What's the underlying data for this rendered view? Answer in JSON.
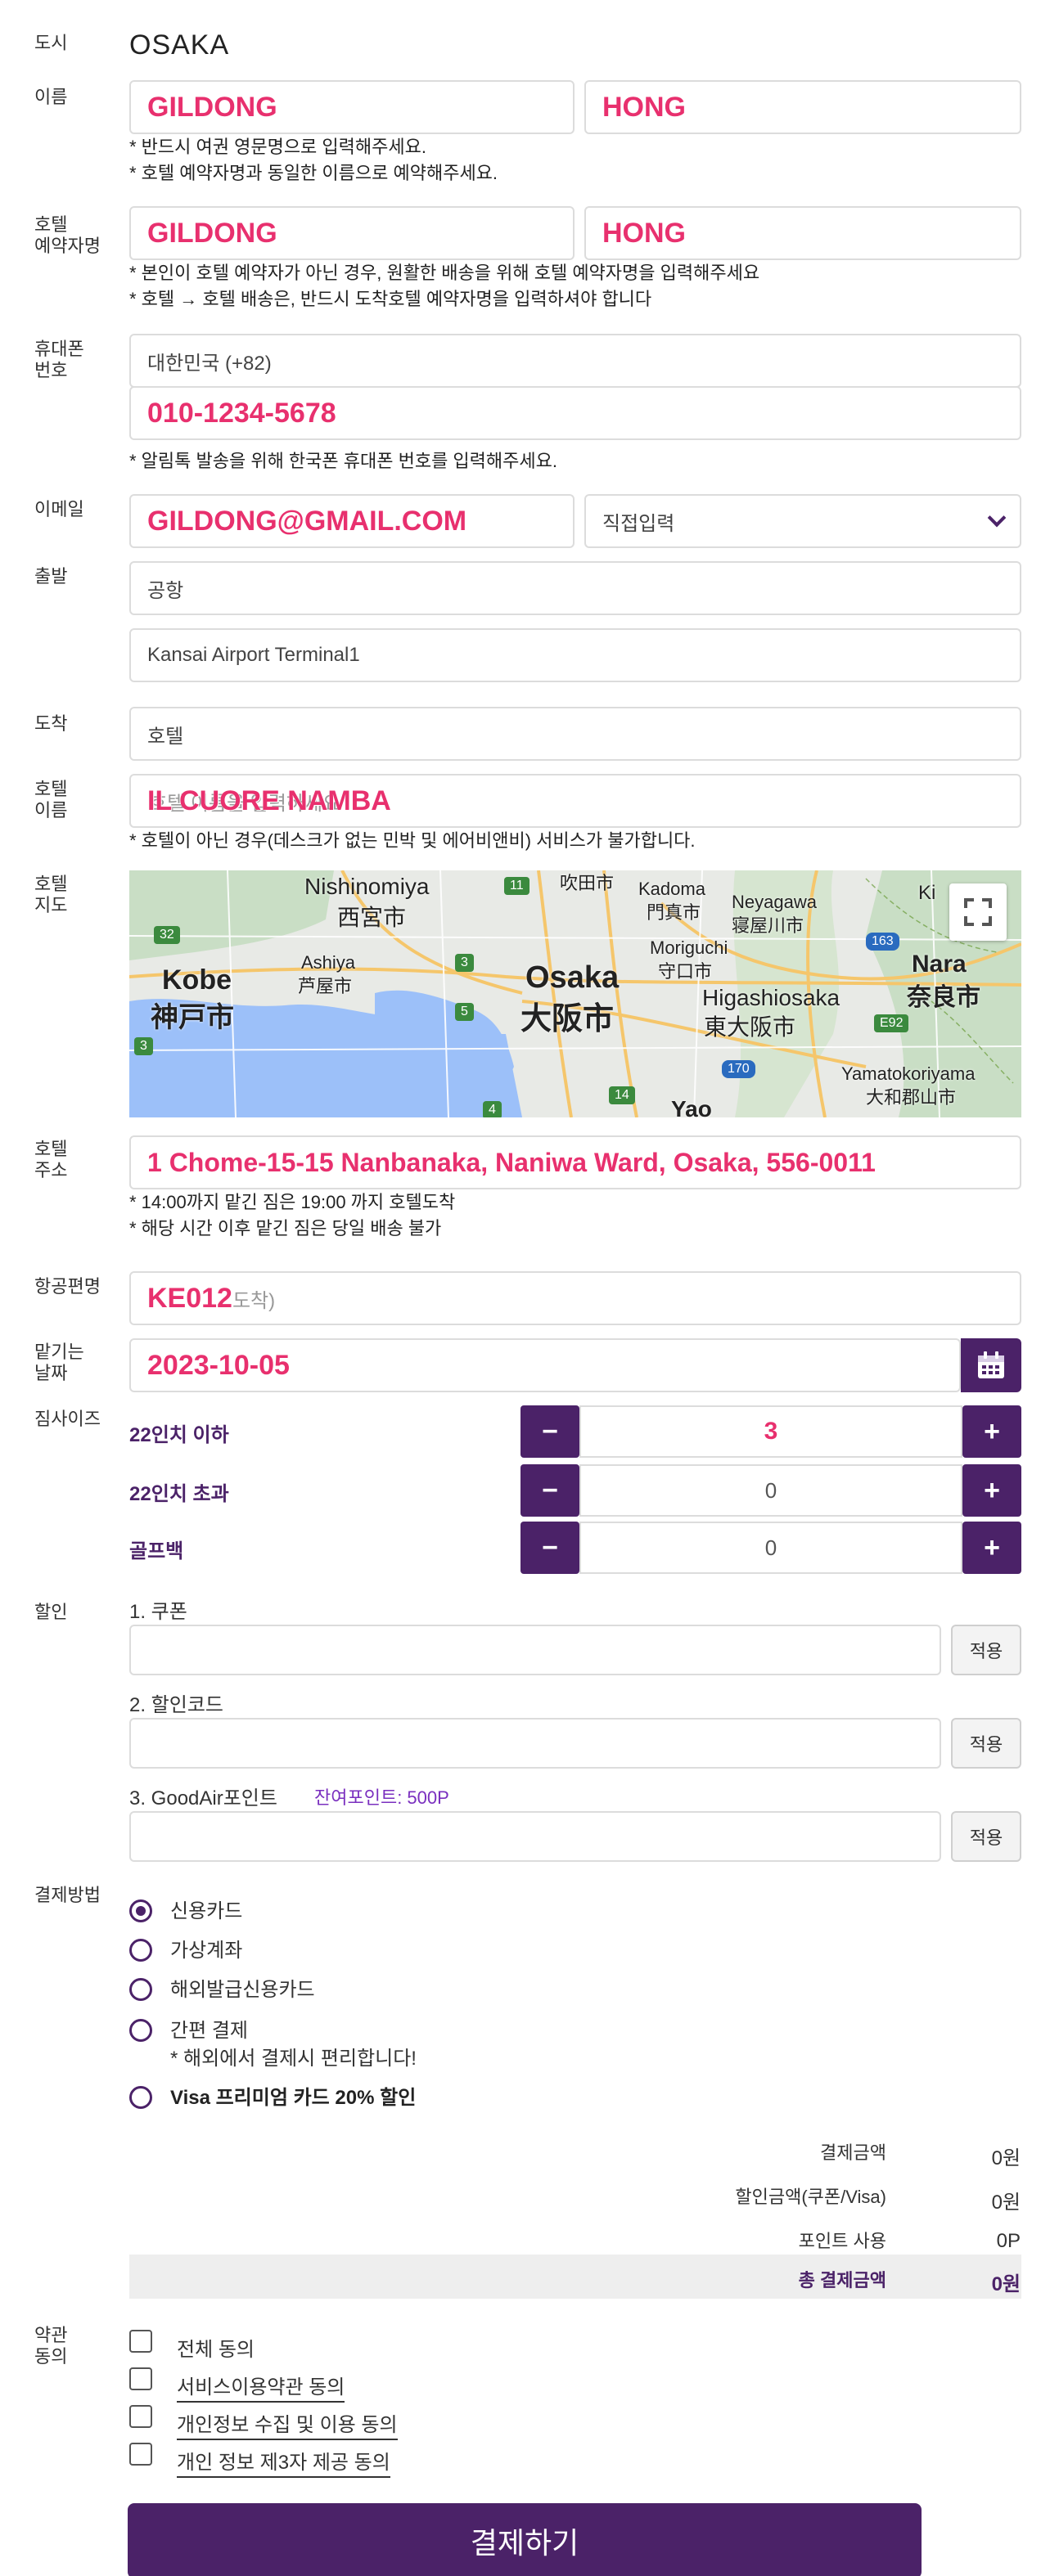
{
  "city": {
    "label": "도시",
    "value": "OSAKA"
  },
  "name": {
    "label": "이름",
    "first": "GILDONG",
    "last": "HONG",
    "notes": [
      "* 반드시 여권 영문명으로 입력해주세요.",
      "* 호텔 예약자명과 동일한 이름으로 예약해주세요."
    ]
  },
  "hotel_reservation_name": {
    "label": "호텔\n예약자명",
    "first": "GILDONG",
    "last": "HONG",
    "notes": [
      "* 본인이 호텔 예약자가 아닌 경우, 원활한 배송을 위해 호텔 예약자명을 입력해주세요",
      "* 호텔 → 호텔 배송은, 반드시 도착호텔 예약자명을 입력하셔야 합니다"
    ]
  },
  "phone": {
    "label": "휴대폰\n번호",
    "country": "대한민국 (+82)",
    "number": "010-1234-5678",
    "note": "* 알림톡 발송을 위해 한국폰 휴대폰 번호를 입력해주세요."
  },
  "email": {
    "label": "이메일",
    "value": "GILDONG@GMAIL.COM",
    "domain_select": "직접입력"
  },
  "departure": {
    "label": "출발",
    "type": "공항",
    "place": "Kansai Airport Terminal1"
  },
  "arrival": {
    "label": "도착",
    "type": "호텔"
  },
  "hotel_name": {
    "label": "호텔\n이름",
    "value": "IL CUORE NAMBA",
    "ghost_placeholder": "호텔 이름을 입력하세요",
    "note": "* 호텔이 아닌 경우(데스크가 없는 민박 및 에어비앤비) 서비스가 불가합니다."
  },
  "hotel_map": {
    "label": "호텔\n지도",
    "places": {
      "kobe_en": "Kobe",
      "kobe_jp": "神戸市",
      "nishinomiya_en": "Nishinomiya",
      "nishinomiya_jp": "西宮市",
      "ashiya_en": "Ashiya",
      "ashiya_jp": "芦屋市",
      "suita": "吹田市",
      "kadoma_en": "Kadoma",
      "kadoma_jp": "門真市",
      "neyagawa_en": "Neyagawa",
      "neyagawa_jp": "寝屋川市",
      "moriguchi_en": "Moriguchi",
      "moriguchi_jp": "守口市",
      "osaka_en": "Osaka",
      "osaka_jp": "大阪市",
      "higashiosaka_en": "Higashiosaka",
      "higashiosaka_jp": "東大阪市",
      "nara_en": "Nara",
      "nara_jp": "奈良市",
      "yamatokoriyama_en": "Yamatokoriyama",
      "yamatokoriyama_jp": "大和郡山市",
      "yao": "Yao",
      "ki": "Ki"
    },
    "routes": [
      "32",
      "3",
      "11",
      "3",
      "5",
      "4",
      "14",
      "163",
      "170",
      "E92",
      "3"
    ]
  },
  "hotel_address": {
    "label": "호텔\n주소",
    "value": "1 Chome-15-15 Nanbanaka, Naniwa Ward, Osaka, 556-0011",
    "notes": [
      "* 14:00까지 맡긴 짐은 19:00 까지 호텔도착",
      "* 해당 시간 이후 맡긴 짐은 당일 배송 불가"
    ]
  },
  "flight": {
    "label": "항공편명",
    "value": "KE012",
    "ghost_suffix": "도착)"
  },
  "drop_date": {
    "label": "맡기는\n날짜",
    "value": "2023-10-05"
  },
  "luggage": {
    "label": "짐사이즈",
    "items": [
      {
        "name": "22인치 이하",
        "count": "3"
      },
      {
        "name": "22인치 초과",
        "count": "0"
      },
      {
        "name": "골프백",
        "count": "0"
      }
    ],
    "minus": "−",
    "plus": "+"
  },
  "discount": {
    "label": "할인",
    "coupon_label": "1. 쿠폰",
    "code_label": "2. 할인코드",
    "points_label": "3. GoodAir포인트",
    "points_remaining": "잔여포인트: 500P",
    "apply": "적용"
  },
  "payment": {
    "label": "결제방법",
    "options": [
      "신용카드",
      "가상계좌",
      "해외발급신용카드",
      "간편 결제",
      "Visa 프리미엄 카드 20% 할인"
    ],
    "simple_note": "* 해외에서 결제시 편리합니다!",
    "selected": "신용카드"
  },
  "summary": {
    "amount_label": "결제금액",
    "amount": "0원",
    "discount_label": "할인금액(쿠폰/Visa)",
    "discount": "0원",
    "points_label": "포인트 사용",
    "points": "0P",
    "total_label": "총 결제금액",
    "total": "0원"
  },
  "terms": {
    "label": "약관\n동의",
    "items": [
      "전체 동의",
      "서비스이용약관 동의",
      "개인정보 수집 및 이용 동의",
      "개인 정보 제3자 제공 동의"
    ]
  },
  "submit": "결제하기",
  "colors": {
    "brand": "#4b2268",
    "highlight": "#e8306e",
    "map_water": "#9cc0f9",
    "map_land": "#e8eae6"
  }
}
